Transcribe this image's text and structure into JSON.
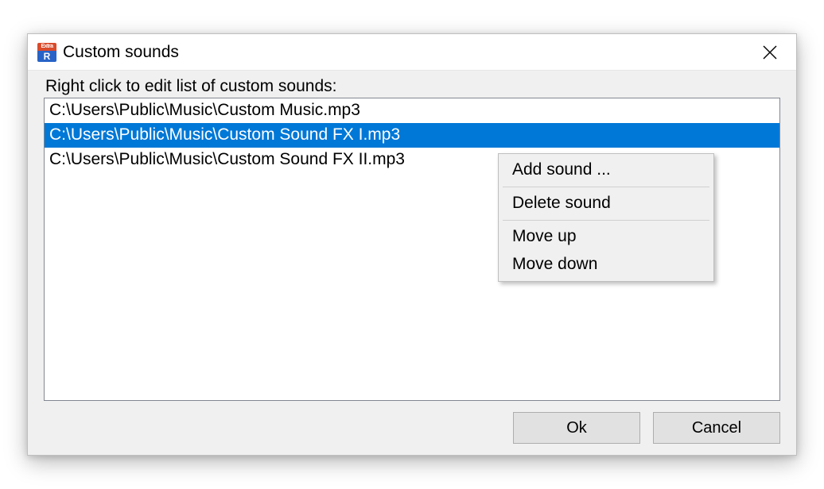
{
  "window": {
    "title": "Custom sounds",
    "icon_top": "Extra",
    "icon_bot": "R"
  },
  "group_label": "Right click to edit list of custom sounds:",
  "list_items": [
    "C:\\Users\\Public\\Music\\Custom Music.mp3",
    "C:\\Users\\Public\\Music\\Custom Sound FX I.mp3",
    "C:\\Users\\Public\\Music\\Custom Sound FX II.mp3"
  ],
  "selected_index": 1,
  "context_menu": {
    "add_sound": "Add sound ...",
    "delete_sound": "Delete sound",
    "move_up": "Move up",
    "move_down": "Move down"
  },
  "buttons": {
    "ok": "Ok",
    "cancel": "Cancel"
  }
}
